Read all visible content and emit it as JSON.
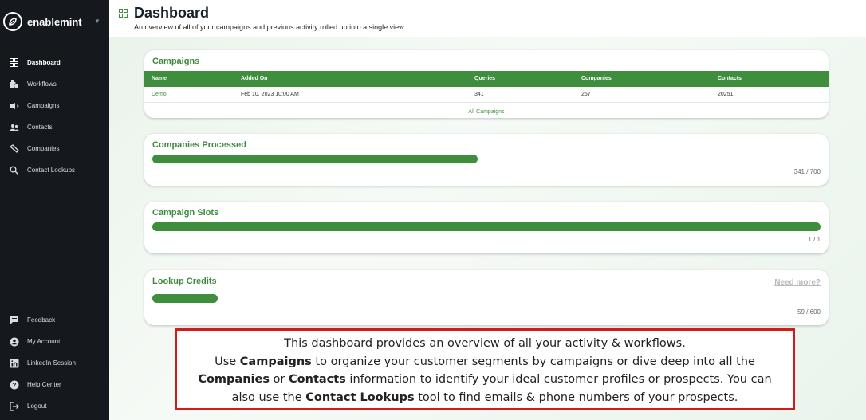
{
  "brand": {
    "name": "enablemint"
  },
  "sidebar": {
    "items": [
      {
        "label": "Dashboard",
        "icon": "dashboard-icon"
      },
      {
        "label": "Workflows",
        "icon": "workflow-icon"
      },
      {
        "label": "Campaigns",
        "icon": "megaphone-icon"
      },
      {
        "label": "Contacts",
        "icon": "people-icon"
      },
      {
        "label": "Companies",
        "icon": "handshake-icon"
      },
      {
        "label": "Contact Lookups",
        "icon": "search-icon"
      }
    ],
    "bottom_items": [
      {
        "label": "Feedback",
        "icon": "feedback-icon"
      },
      {
        "label": "My Account",
        "icon": "account-icon"
      },
      {
        "label": "LinkedIn Session",
        "icon": "linkedin-icon"
      },
      {
        "label": "Help Center",
        "icon": "help-icon"
      },
      {
        "label": "Logout",
        "icon": "logout-icon"
      }
    ]
  },
  "header": {
    "title": "Dashboard",
    "subtitle": "An overview of all of your campaigns and previous activity rolled up into a single view"
  },
  "campaigns": {
    "title": "Campaigns",
    "columns": [
      "Name",
      "Added On",
      "Queries",
      "Companies",
      "Contacts"
    ],
    "rows": [
      {
        "name": "Demo",
        "added_on": "Feb 10, 2023 10:00 AM",
        "queries": "341",
        "companies": "257",
        "contacts": "20251"
      }
    ],
    "all_link": "All Campaigns"
  },
  "companies_processed": {
    "title": "Companies Processed",
    "count_text": "341 / 700",
    "fraction": 0.487
  },
  "campaign_slots": {
    "title": "Campaign Slots",
    "count_text": "1 / 1",
    "fraction": 1.0
  },
  "lookup_credits": {
    "title": "Lookup Credits",
    "need_more": "Need more?",
    "count_text": "59 / 600",
    "fraction": 0.098
  },
  "annotation": {
    "line1": "This dashboard provides an overview of all your activity & workflows.",
    "l2a": "Use ",
    "l2b": "Campaigns",
    "l2c": " to organize your customer segments by campaigns or dive deep into all the",
    "l3a": "Companies",
    "l3b": " or ",
    "l3c": "Contacts",
    "l3d": " information to identify your ideal customer profiles or prospects. You can",
    "l4a": "also use the ",
    "l4b": "Contact Lookups",
    "l4c": " tool to find emails & phone numbers of your prospects."
  },
  "colors": {
    "sidebar_bg": "#15191e",
    "accent": "#3e8e3e",
    "annotation_border": "#d11b1b"
  }
}
